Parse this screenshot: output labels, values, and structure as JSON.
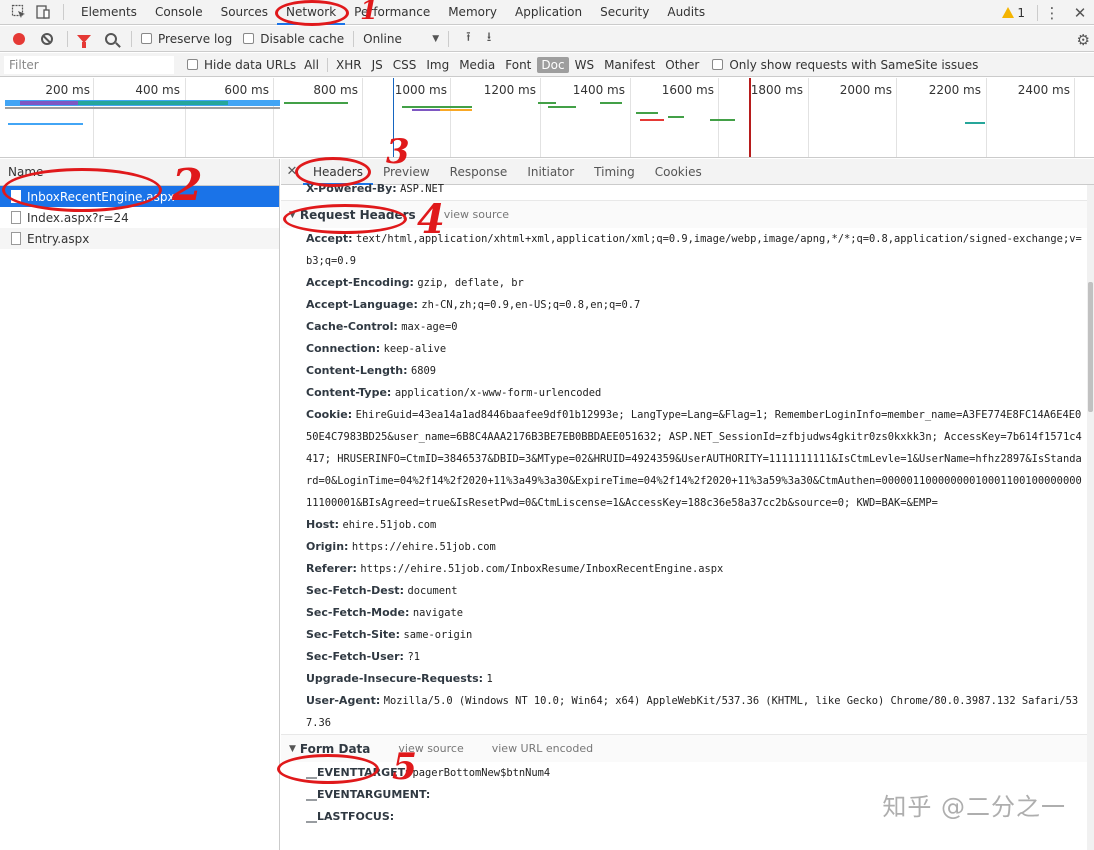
{
  "topbar": {
    "tabs": [
      "Elements",
      "Console",
      "Sources",
      "Network",
      "Performance",
      "Memory",
      "Application",
      "Security",
      "Audits"
    ],
    "active_tab": "Network",
    "warning_count": "1"
  },
  "toolbar": {
    "preserve_log": "Preserve log",
    "disable_cache": "Disable cache",
    "throttling": "Online"
  },
  "filter": {
    "placeholder": "Filter",
    "hide_data_urls": "Hide data URLs",
    "types": [
      "All",
      "XHR",
      "JS",
      "CSS",
      "Img",
      "Media",
      "Font",
      "Doc",
      "WS",
      "Manifest",
      "Other"
    ],
    "active_type": "Doc",
    "samesite": "Only show requests with SameSite issues"
  },
  "overview": {
    "ticks": [
      "200 ms",
      "400 ms",
      "600 ms",
      "800 ms",
      "1000 ms",
      "1200 ms",
      "1400 ms",
      "1600 ms",
      "1800 ms",
      "2000 ms",
      "2200 ms",
      "2400 ms"
    ]
  },
  "requests": {
    "header": "Name",
    "items": [
      {
        "name": "InboxRecentEngine.aspx"
      },
      {
        "name": "Index.aspx?r=24"
      },
      {
        "name": "Entry.aspx"
      }
    ]
  },
  "detail": {
    "tabs": [
      "Headers",
      "Preview",
      "Response",
      "Initiator",
      "Timing",
      "Cookies"
    ],
    "active_tab": "Headers",
    "partial_header": {
      "k": "X-Powered-By:",
      "v": "ASP.NET"
    },
    "request_headers_title": "Request Headers",
    "view_source": "view source",
    "request_headers": [
      {
        "k": "Accept:",
        "v": "text/html,application/xhtml+xml,application/xml;q=0.9,image/webp,image/apng,*/*;q=0.8,application/signed-exchange;v=b3;q=0.9"
      },
      {
        "k": "Accept-Encoding:",
        "v": "gzip, deflate, br"
      },
      {
        "k": "Accept-Language:",
        "v": "zh-CN,zh;q=0.9,en-US;q=0.8,en;q=0.7"
      },
      {
        "k": "Cache-Control:",
        "v": "max-age=0"
      },
      {
        "k": "Connection:",
        "v": "keep-alive"
      },
      {
        "k": "Content-Length:",
        "v": "6809"
      },
      {
        "k": "Content-Type:",
        "v": "application/x-www-form-urlencoded"
      },
      {
        "k": "Cookie:",
        "v": "EhireGuid=43ea14a1ad8446baafee9df01b12993e; LangType=Lang=&Flag=1; RememberLoginInfo=member_name=A3FE774E8FC14A6E4E050E4C7983BD25&user_name=6B8C4AAA2176B3BE7EB0BBDAEE051632; ASP.NET_SessionId=zfbjudws4gkitr0zs0kxkk3n; AccessKey=7b614f1571c4417; HRUSERINFO=CtmID=3846537&DBID=3&MType=02&HRUID=4924359&UserAUTHORITY=1111111111&IsCtmLevle=1&UserName=hfhz2897&IsStandard=0&LoginTime=04%2f14%2f2020+11%3a49%3a30&ExpireTime=04%2f14%2f2020+11%3a59%3a30&CtmAuthen=0000011000000001000110010000000011100001&BIsAgreed=true&IsResetPwd=0&CtmLiscense=1&AccessKey=188c36e58a37cc2b&source=0; KWD=BAK=&EMP="
      },
      {
        "k": "Host:",
        "v": "ehire.51job.com"
      },
      {
        "k": "Origin:",
        "v": "https://ehire.51job.com"
      },
      {
        "k": "Referer:",
        "v": "https://ehire.51job.com/InboxResume/InboxRecentEngine.aspx"
      },
      {
        "k": "Sec-Fetch-Dest:",
        "v": "document"
      },
      {
        "k": "Sec-Fetch-Mode:",
        "v": "navigate"
      },
      {
        "k": "Sec-Fetch-Site:",
        "v": "same-origin"
      },
      {
        "k": "Sec-Fetch-User:",
        "v": "?1"
      },
      {
        "k": "Upgrade-Insecure-Requests:",
        "v": "1"
      },
      {
        "k": "User-Agent:",
        "v": "Mozilla/5.0 (Windows NT 10.0; Win64; x64) AppleWebKit/537.36 (KHTML, like Gecko) Chrome/80.0.3987.132 Safari/537.36"
      }
    ],
    "form_data_title": "Form Data",
    "view_url_encoded": "view URL encoded",
    "form_data": [
      {
        "k": "__EVENTTARGET:",
        "v": "pagerBottomNew$btnNum4"
      },
      {
        "k": "__EVENTARGUMENT:",
        "v": ""
      },
      {
        "k": "__LASTFOCUS:",
        "v": ""
      }
    ]
  },
  "annotations": [
    "1",
    "2",
    "3",
    "4",
    "5"
  ],
  "watermark": "知乎 @二分之一"
}
